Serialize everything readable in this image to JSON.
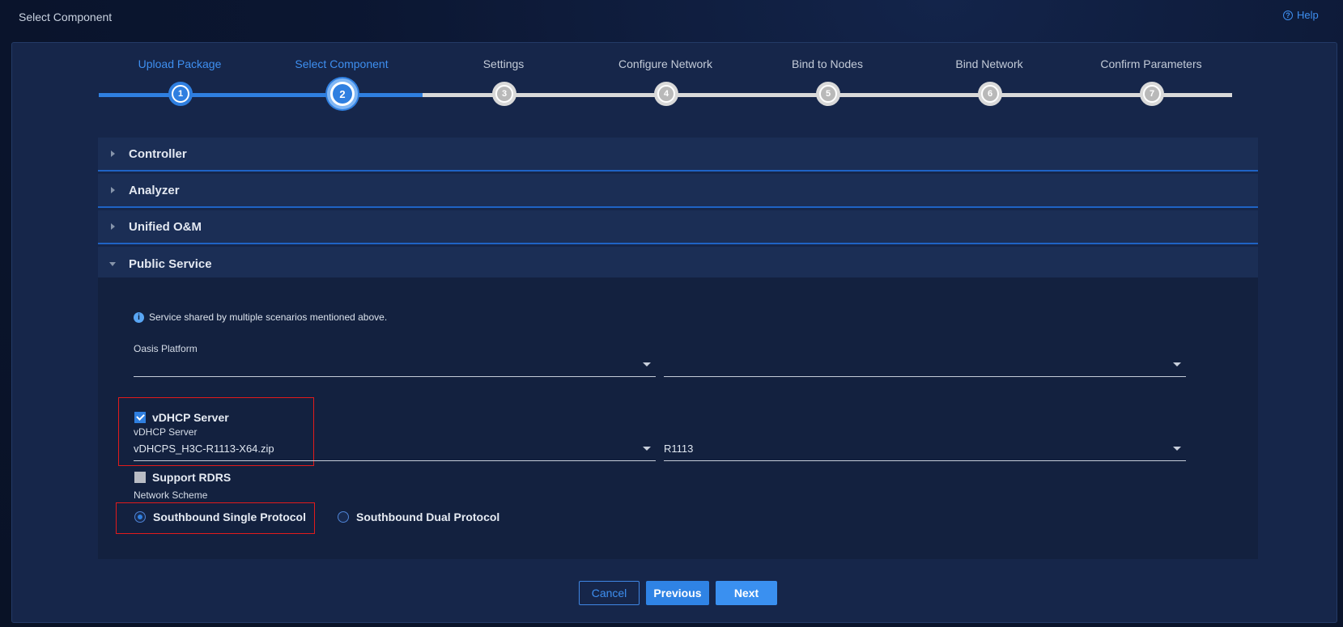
{
  "window": {
    "title": "Select Component",
    "help_label": "Help",
    "help_icon": "question-circle-icon"
  },
  "steps": [
    {
      "number": "1",
      "label": "Upload Package",
      "state": "done"
    },
    {
      "number": "2",
      "label": "Select Component",
      "state": "active"
    },
    {
      "number": "3",
      "label": "Settings",
      "state": "pending"
    },
    {
      "number": "4",
      "label": "Configure Network",
      "state": "pending"
    },
    {
      "number": "5",
      "label": "Bind to Nodes",
      "state": "pending"
    },
    {
      "number": "6",
      "label": "Bind Network",
      "state": "pending"
    },
    {
      "number": "7",
      "label": "Confirm Parameters",
      "state": "pending"
    }
  ],
  "sections": [
    {
      "title": "Controller",
      "expanded": false
    },
    {
      "title": "Analyzer",
      "expanded": false
    },
    {
      "title": "Unified O&M",
      "expanded": false
    },
    {
      "title": "Public Service",
      "expanded": true
    }
  ],
  "public_service": {
    "info_text": "Service shared by multiple scenarios mentioned above.",
    "oasis": {
      "label": "Oasis Platform",
      "package_value": "",
      "version_value": ""
    },
    "vdhcp": {
      "checkbox_label": "vDHCP Server",
      "checked": true,
      "field_label": "vDHCP Server",
      "package_value": "vDHCPS_H3C-R1113-X64.zip",
      "version_value": "R1113"
    },
    "rdrs": {
      "checkbox_label": "Support RDRS",
      "checked": false
    },
    "network_scheme": {
      "label": "Network Scheme",
      "options": [
        {
          "label": "Southbound Single Protocol",
          "selected": true
        },
        {
          "label": "Southbound Dual Protocol",
          "selected": false
        }
      ]
    }
  },
  "buttons": {
    "cancel": "Cancel",
    "previous": "Previous",
    "next": "Next"
  },
  "colors": {
    "accent": "#2f7fe0",
    "highlight": "#e21b1b",
    "panel": "#16264a"
  }
}
